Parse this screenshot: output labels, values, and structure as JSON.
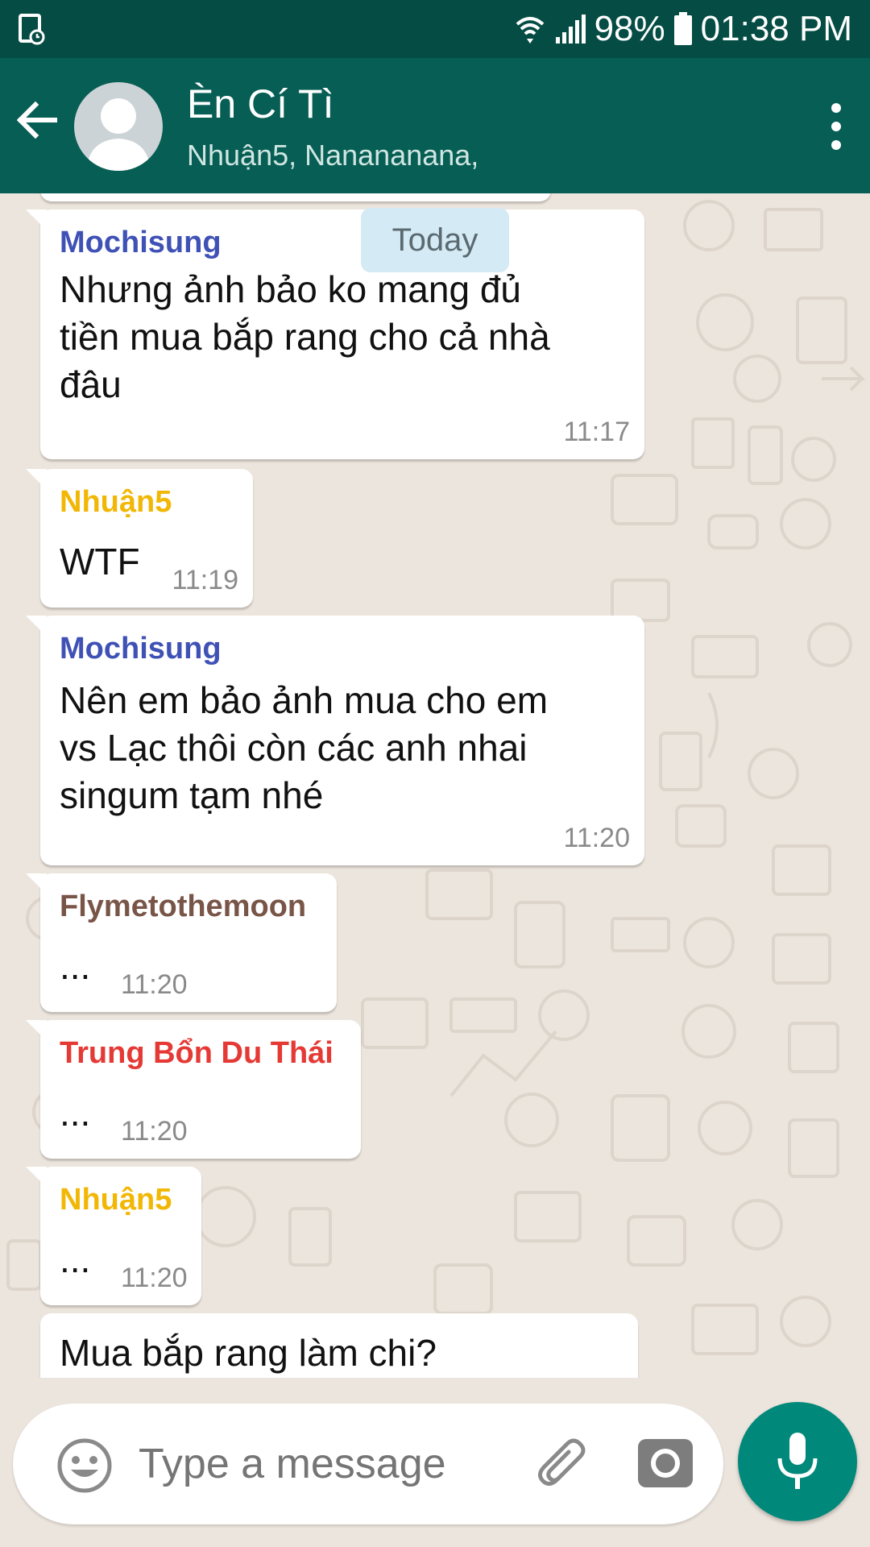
{
  "status_bar": {
    "battery": "98%",
    "time": "01:38 PM"
  },
  "header": {
    "title": "Èn Cí Tì",
    "subtitle": "Nhuận5, Nanananana,"
  },
  "date_divider": "Today",
  "messages": [
    {
      "sender": "Mochisung",
      "sender_color": "#3f51b5",
      "text": "Nhưng ảnh bảo ko mang đủ\ntiền mua bắp rang cho cả nhà\nđâu",
      "time": "11:17"
    },
    {
      "sender": "Nhuận5",
      "sender_color": "#f2b705",
      "text": "WTF",
      "time": "11:19"
    },
    {
      "sender": "Mochisung",
      "sender_color": "#3f51b5",
      "text": "Nên em bảo ảnh mua cho em\nvs Lạc thôi còn các anh nhai\nsingum tạm nhé",
      "time": "11:20"
    },
    {
      "sender": "Flymetothemoon",
      "sender_color": "#795548",
      "text": "...",
      "time": "11:20"
    },
    {
      "sender": "Trung Bổn Du Thái",
      "sender_color": "#e53935",
      "text": "...",
      "time": "11:20"
    },
    {
      "sender": "Nhuận5",
      "sender_color": "#f2b705",
      "text": "...",
      "time": "11:20"
    },
    {
      "sender": "",
      "text": "Mua bắp rang làm chi?",
      "time": ""
    }
  ],
  "composer": {
    "placeholder": "Type a message"
  },
  "colors": {
    "header": "#075e54",
    "status_bar": "#054d44",
    "accent": "#00897b",
    "chat_bg": "#ece5dd"
  },
  "icons": [
    "back-arrow-icon",
    "avatar-placeholder-icon",
    "more-vert-icon",
    "emoji-icon",
    "paperclip-icon",
    "camera-icon",
    "mic-icon"
  ]
}
